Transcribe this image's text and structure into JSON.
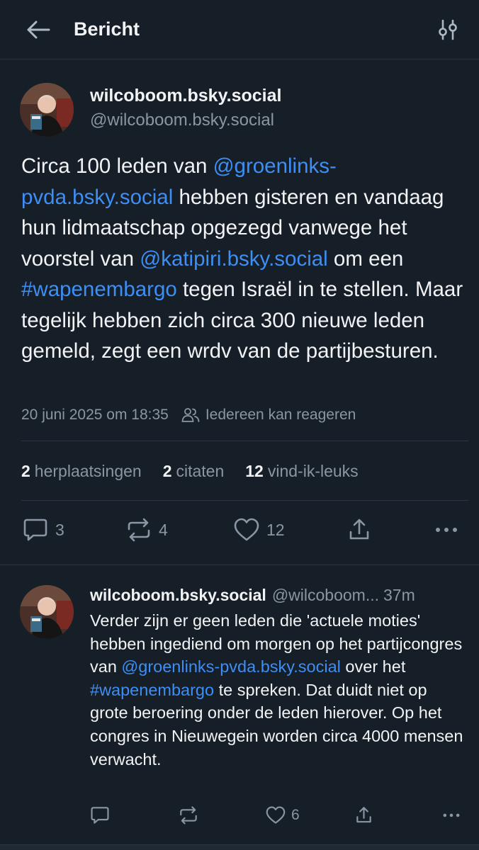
{
  "header": {
    "title": "Bericht",
    "back_icon": "arrow-left-icon",
    "filter_icon": "sliders-icon"
  },
  "post": {
    "author": {
      "display_name": "wilcoboom.bsky.social",
      "handle": "@wilcoboom.bsky.social"
    },
    "text": {
      "t1": "Circa 100 leden van ",
      "m1": "@groenlinks-pvda.bsky.social",
      "t2": " hebben gisteren en vandaag hun lidmaatschap opgezegd vanwege het voorstel van ",
      "m2": "@katipiri.bsky.social",
      "t3": " om een ",
      "h1": "#wapenembargo",
      "t4": " tegen Israël in te stellen. Maar tegelijk hebben zich circa 300 nieuwe leden gemeld, zegt een wrdv van de partijbesturen."
    },
    "timestamp": "20 juni 2025 om 18:35",
    "reply_setting": "Iedereen kan reageren",
    "stats": {
      "reposts_count": "2",
      "reposts_label": "herplaatsingen",
      "quotes_count": "2",
      "quotes_label": "citaten",
      "likes_count": "12",
      "likes_label": "vind-ik-leuks"
    },
    "actions": {
      "reply_count": "3",
      "repost_count": "4",
      "like_count": "12"
    }
  },
  "reply": {
    "author": {
      "display_name": "wilcoboom.bsky.social",
      "handle": "@wilcoboom...",
      "time": "37m"
    },
    "text": {
      "t1": "Verder zijn er geen leden die 'actuele moties' hebben ingediend om morgen op het partijcongres van ",
      "m1": "@groenlinks-pvda.bsky.social",
      "t2": " over het ",
      "h1": "#wapenembargo",
      "t3": " te spreken. Dat duidt niet op grote beroering onder de leden hierover. Op het congres in Nieuwegein worden circa 4000 mensen verwacht."
    },
    "actions": {
      "like_count": "6"
    }
  },
  "colors": {
    "background": "#161e27",
    "link": "#3d8ef5",
    "muted": "#8a96a3",
    "text": "#f1f3f5"
  }
}
